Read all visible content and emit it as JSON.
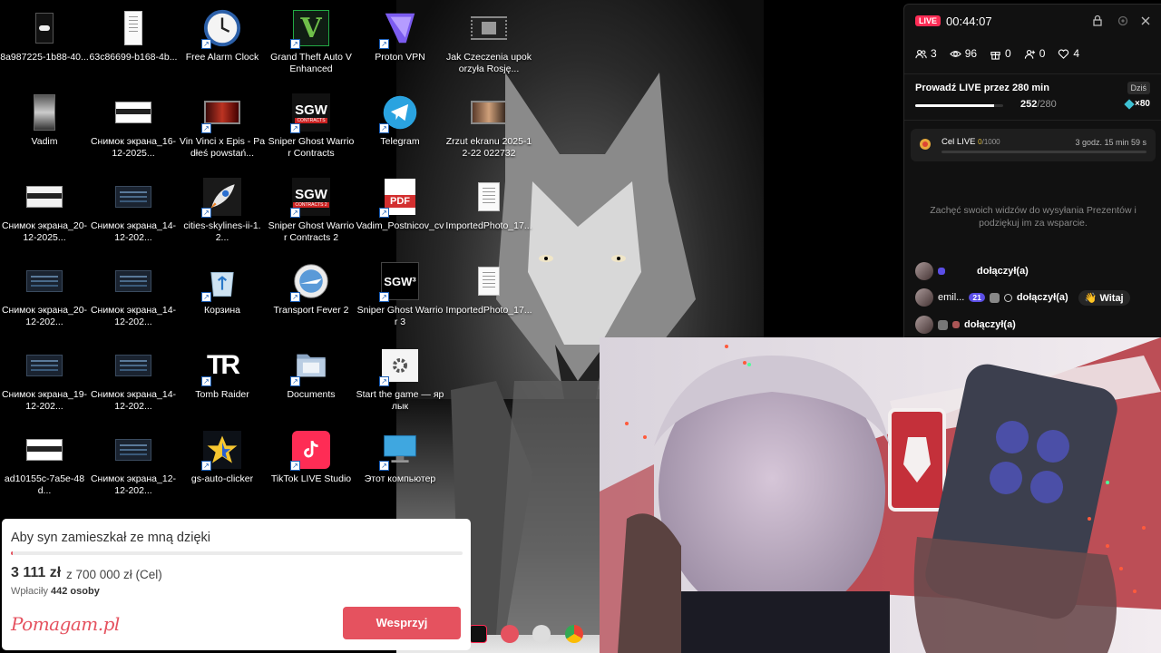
{
  "desktop": {
    "icons": [
      {
        "label": "8a987225-1b88-40...",
        "type": "img-dark"
      },
      {
        "label": "63c86699-b168-4b...",
        "type": "img-white"
      },
      {
        "label": "Free Alarm Clock",
        "type": "clock"
      },
      {
        "label": "Grand Theft Auto V Enhanced",
        "type": "gta"
      },
      {
        "label": "Proton VPN",
        "type": "vpn"
      },
      {
        "label": "Jak Czeczenia upokorzyła Rosję...",
        "type": "video"
      },
      {
        "label": "Vadim",
        "type": "wolf"
      },
      {
        "label": "Снимок экрана_16-12-2025...",
        "type": "shot-light"
      },
      {
        "label": "Vin Vinci x Epis - Padłeś powstań...",
        "type": "video-red"
      },
      {
        "label": "Sniper Ghost Warrior Contracts",
        "type": "sgw",
        "badge": "CONTRACTS"
      },
      {
        "label": "Telegram",
        "type": "telegram"
      },
      {
        "label": "Zrzut ekranu 2025-12-22 022732",
        "type": "shot-photo"
      },
      {
        "label": "Снимок экрана_20-12-2025...",
        "type": "shot-white"
      },
      {
        "label": "Снимок экрана_14-12-202...",
        "type": "shot-dark"
      },
      {
        "label": "cities-skylines-ii-1.2...",
        "type": "rocket"
      },
      {
        "label": "Sniper Ghost Warrior Contracts 2",
        "type": "sgw",
        "badge": "CONTRACTS 2"
      },
      {
        "label": "Vadim_Postnicov_cv",
        "type": "pdf"
      },
      {
        "label": "ImportedPhoto_17...",
        "type": "doc"
      },
      {
        "label": "Снимок экрана_20-12-202...",
        "type": "shot-dark"
      },
      {
        "label": "Снимок экрана_14-12-202...",
        "type": "shot-dark"
      },
      {
        "label": "Корзина",
        "type": "bin"
      },
      {
        "label": "Transport Fever 2",
        "type": "tf2"
      },
      {
        "label": "Sniper Ghost Warrior 3",
        "type": "sgw3"
      },
      {
        "label": "ImportedPhoto_17...",
        "type": "doc"
      },
      {
        "label": "Снимок экрана_19-12-202...",
        "type": "shot-dark"
      },
      {
        "label": "Снимок экрана_14-12-202...",
        "type": "shot-dark"
      },
      {
        "label": "Tomb Raider",
        "type": "tr"
      },
      {
        "label": "Documents",
        "type": "folder"
      },
      {
        "label": "Start the game — ярлык",
        "type": "gear"
      },
      {
        "label": "ad10155c-7a5e-48d...",
        "type": "shot-light"
      },
      {
        "label": "Снимок экрана_12-12-202...",
        "type": "shot-dark"
      },
      {
        "label": "gs-auto-clicker",
        "type": "star"
      },
      {
        "label": "TikTok LIVE Studio",
        "type": "tiktok"
      },
      {
        "label": "Этот компьютер",
        "type": "pc"
      }
    ],
    "text_sgw": "SGW",
    "text_sgw3": "SGW³",
    "text_tr": "TR",
    "text_pdf": "PDF"
  },
  "live_panel": {
    "badge": "LIVE",
    "timer": "00:44:07",
    "stats": [
      {
        "icon": "users-icon",
        "value": "3"
      },
      {
        "icon": "eye-icon",
        "value": "96"
      },
      {
        "icon": "gift-icon",
        "value": "0"
      },
      {
        "icon": "user-plus-icon",
        "value": "0"
      },
      {
        "icon": "heart-icon",
        "value": "4"
      }
    ],
    "goal_title": "Prowadź LIVE przez 280 min",
    "today": "Dziś",
    "goal_current": "252",
    "goal_total": "/280",
    "goal_fraction": 0.9,
    "gems": "×80",
    "cel_title": "Cel LIVE",
    "cel_current": "0",
    "cel_total": "/1000",
    "cel_fraction": 0.0,
    "cel_time": "3 godz. 15 min 59 s",
    "encourage": "Zachęć swoich widzów do wysyłania Prezentów i podziękuj im za wsparcie.",
    "chat": [
      {
        "name": "",
        "level": "",
        "joined": "dołączył(a)",
        "wave": ""
      },
      {
        "name": "emil...",
        "level": "21",
        "joined": "dołączył(a)",
        "wave": "Witaj"
      },
      {
        "name": "",
        "level": "",
        "joined": "dołączył(a)",
        "wave": ""
      }
    ]
  },
  "fundraiser": {
    "title": "Aby syn zamieszkał ze mną dzięki",
    "raised": "3 111 zł",
    "goal": "z 700 000 zł (Cel)",
    "fraction": 0.0044,
    "count_label": "Wpłaciły",
    "count_value": "442 osoby",
    "logo": "Pomagam.pl",
    "button": "Wesprzyj"
  },
  "colors": {
    "tiktok_red": "#fe2c55",
    "pomagam_red": "#e5525f",
    "cel_gold": "#e3c13c",
    "level_purple": "#5b4ee6"
  }
}
